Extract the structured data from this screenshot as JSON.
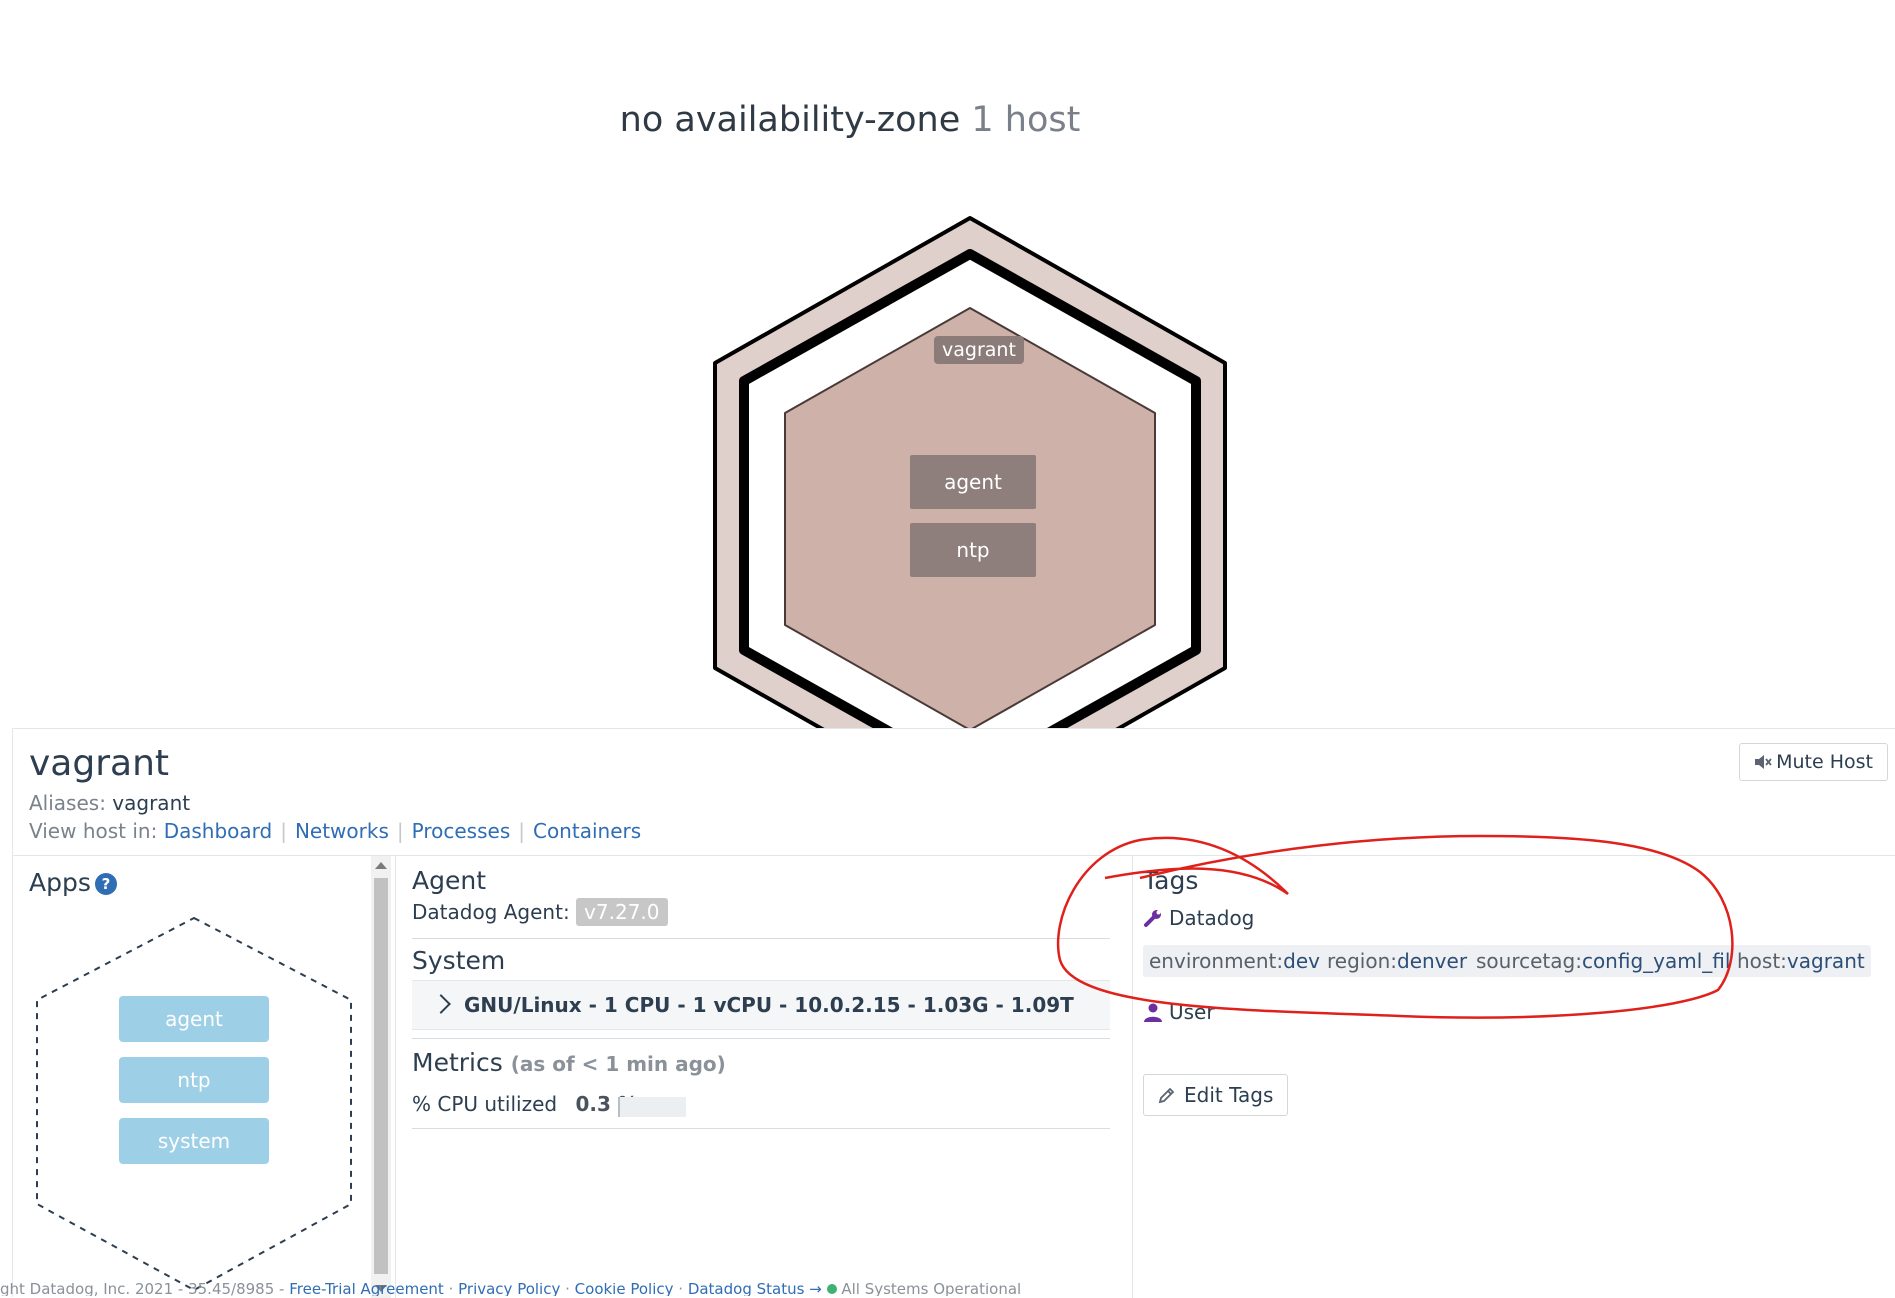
{
  "zone": {
    "name": "no availability-zone",
    "count": "1 host"
  },
  "hexmap": {
    "host_label": "vagrant",
    "apps": [
      "agent",
      "ntp"
    ]
  },
  "host": {
    "name": "vagrant",
    "aliases_label": "Aliases:",
    "aliases_value": "vagrant",
    "view_in_label": "View host in:",
    "links": [
      "Dashboard",
      "Networks",
      "Processes",
      "Containers"
    ],
    "mute_label": "Mute Host"
  },
  "apps_panel": {
    "title": "Apps",
    "apps": [
      "agent",
      "ntp",
      "system"
    ]
  },
  "agent": {
    "title": "Agent",
    "label": "Datadog Agent:",
    "version": "v7.27.0"
  },
  "system": {
    "title": "System",
    "summary": "GNU/Linux - 1 CPU - 1 vCPU - 10.0.2.15 - 1.03G - 1.09T"
  },
  "metrics": {
    "title": "Metrics",
    "as_of": "(as of < 1 min ago)",
    "cpu_label": "% CPU utilized",
    "cpu_value": "0.3 %",
    "cpu_fraction": 0.003
  },
  "tags": {
    "title": "Tags",
    "source_datadog": "Datadog",
    "items": [
      {
        "key": "environment:",
        "value": "dev"
      },
      {
        "key": "region:",
        "value": "denver"
      },
      {
        "key": "sourcetag:",
        "value": "config_yaml_file"
      },
      {
        "key": "host:",
        "value": "vagrant"
      }
    ],
    "source_user": "User",
    "edit_label": "Edit Tags"
  },
  "footer": {
    "copyright": "ght Datadog, Inc. 2021 - 35.45/8985 -",
    "links": [
      "Free-Trial Agreement",
      "Privacy Policy",
      "Cookie Policy",
      "Datadog Status →"
    ],
    "status": "All Systems Operational"
  },
  "colors": {
    "accent": "#2f6db5",
    "hex_fill": "#ceb2aa",
    "app_tile": "#8e7f7c",
    "app_pill": "#9dcfe6",
    "annotation": "#e0201a"
  }
}
